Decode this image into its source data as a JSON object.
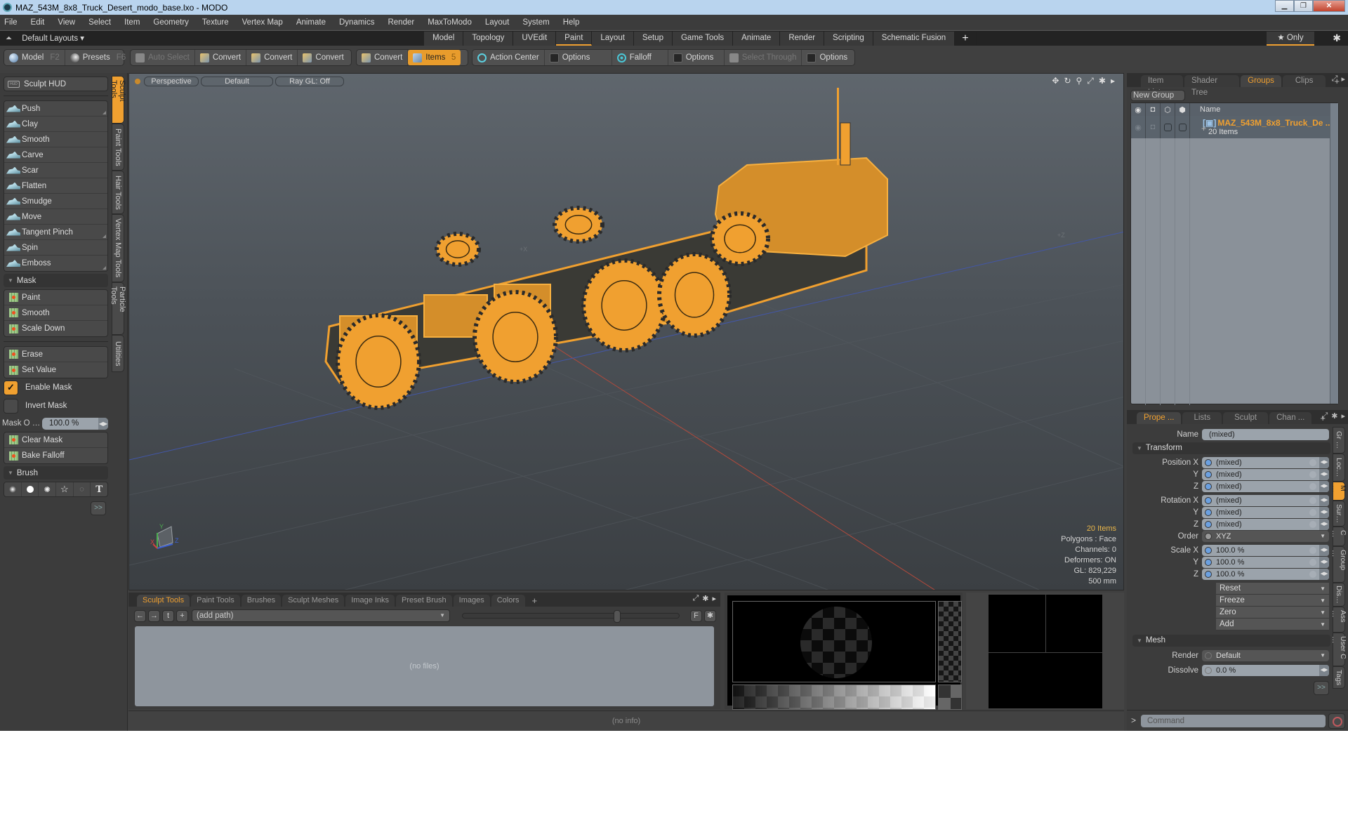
{
  "window": {
    "title": "MAZ_543M_8x8_Truck_Desert_modo_base.lxo - MODO",
    "minimize": "▁",
    "restore": "❐",
    "close": "✕"
  },
  "menu": [
    "File",
    "Edit",
    "View",
    "Select",
    "Item",
    "Geometry",
    "Texture",
    "Vertex Map",
    "Animate",
    "Dynamics",
    "Render",
    "MaxToModo",
    "Layout",
    "System",
    "Help"
  ],
  "layoutbar": {
    "default_layouts": "Default Layouts ▾",
    "tabs": [
      "Model",
      "Topology",
      "UVEdit",
      "Paint",
      "Layout",
      "Setup",
      "Game Tools",
      "Animate",
      "Render",
      "Scripting",
      "Schematic Fusion"
    ],
    "active_tab": "Paint",
    "add": "+",
    "only": "★ Only",
    "gear": "✱"
  },
  "toolbar": {
    "model": "Model",
    "model_key": "F2",
    "presets": "Presets",
    "presets_key": "F6",
    "auto_select": "Auto Select",
    "convert1": "Convert",
    "convert2": "Convert",
    "convert3": "Convert",
    "convert4": "Convert",
    "items": "Items",
    "items_count": "5",
    "action_center": "Action Center",
    "options1": "Options",
    "falloff": "Falloff",
    "options2": "Options",
    "select_through": "Select Through",
    "options3": "Options"
  },
  "left_panel": {
    "sculpt_hud": "Sculpt HUD",
    "tools": [
      "Push",
      "Clay",
      "Smooth",
      "Carve",
      "Scar",
      "Flatten",
      "Smudge",
      "Move",
      "Tangent Pinch",
      "Spin",
      "Emboss"
    ],
    "mask_section": "Mask",
    "mask_tools": [
      "Paint",
      "Smooth",
      "Scale Down"
    ],
    "mask_tools2": [
      "Erase",
      "Set Value"
    ],
    "enable_mask": {
      "label": "Enable Mask",
      "checked": true
    },
    "invert_mask": {
      "label": "Invert Mask",
      "checked": false
    },
    "mask_opacity": {
      "label": "Mask O …",
      "value": "100.0 %"
    },
    "mask_actions": [
      "Clear Mask",
      "Bake Falloff"
    ],
    "brush_section": "Brush",
    "brush_icons": [
      "soft-brush",
      "hard-brush",
      "scatter-brush",
      "star-brush",
      "procedural-brush",
      "text-brush"
    ],
    "more": ">>",
    "vertical_tabs": [
      "Sculpt Tools",
      "Paint Tools",
      "Hair Tools",
      "Vertex Map Tools",
      "Particle Tools",
      "Utilities"
    ],
    "active_vertical_tab": "Sculpt Tools"
  },
  "viewport": {
    "view": "Perspective",
    "shading": "Default",
    "raygl": "Ray GL: Off",
    "axis_x_label": "+X",
    "axis_z_label": "+Z",
    "info": {
      "items": "20 Items",
      "polygons": "Polygons : Face",
      "channels": "Channels: 0",
      "deformers": "Deformers: ON",
      "gl": "GL: 829,229",
      "scale": "500 mm"
    },
    "gizmo": {
      "x": "X",
      "y": "Y",
      "z": "Z"
    },
    "wire_color": "#f0a030"
  },
  "bottom_panel": {
    "tabs": [
      "Sculpt Tools",
      "Paint Tools",
      "Brushes",
      "Sculpt Meshes",
      "Image Inks",
      "Preset Brush",
      "Images",
      "Colors"
    ],
    "active_tab": "Sculpt Tools",
    "add": "+",
    "path": "(add path)",
    "no_files": "(no files)",
    "f_button": "F"
  },
  "status": {
    "info": "(no info)"
  },
  "right_panel": {
    "tabs": [
      "Item List",
      "Shader Tree",
      "Groups",
      "Clips"
    ],
    "active_tab": "Groups",
    "add": "+",
    "new_group": "New Group",
    "columns": {
      "name": "Name"
    },
    "groups": [
      {
        "name": "MAZ_543M_8x8_Truck_De ...",
        "count": "20 Items"
      }
    ]
  },
  "properties": {
    "tabs": [
      "Prope ...",
      "Lists",
      "Sculpt",
      "Chan ..."
    ],
    "active_tab": "Prope ...",
    "add": "+",
    "name_label": "Name",
    "name_value": "(mixed)",
    "transform_section": "Transform",
    "position": {
      "label": "Position X",
      "x": "(mixed)",
      "y": "(mixed)",
      "z": "(mixed)"
    },
    "rotation": {
      "label": "Rotation X",
      "x": "(mixed)",
      "y": "(mixed)",
      "z": "(mixed)"
    },
    "order": {
      "label": "Order",
      "value": "XYZ"
    },
    "scale": {
      "label": "Scale X",
      "x": "100.0 %",
      "y": "100.0 %",
      "z": "100.0 %"
    },
    "axis_y": "Y",
    "axis_z": "Z",
    "actions": [
      "Reset",
      "Freeze",
      "Zero",
      "Add"
    ],
    "mesh_section": "Mesh",
    "render": {
      "label": "Render",
      "value": "Default"
    },
    "dissolve": {
      "label": "Dissolve",
      "value": "0.0 %"
    },
    "more": ">>",
    "vertical_tabs": [
      "Gr …",
      "Loc…",
      "M …",
      "Sur…",
      "C …",
      "Group …",
      "Dis…",
      "Ass …",
      "User C …",
      "Tags"
    ],
    "active_vertical_tab": "M …"
  },
  "command": {
    "prompt": ">",
    "placeholder": "Command"
  }
}
